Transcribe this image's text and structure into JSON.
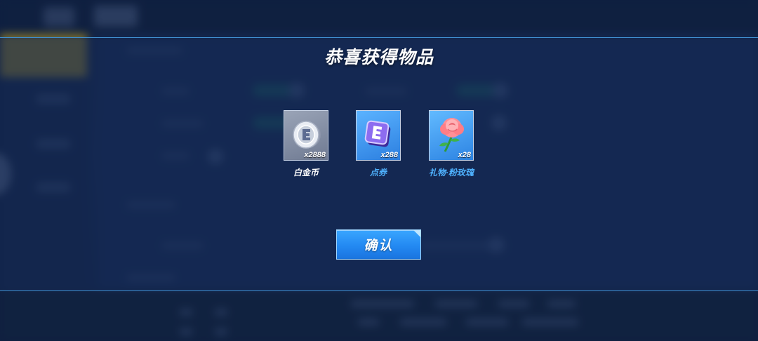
{
  "dialog": {
    "title": "恭喜获得物品",
    "confirm_label": "确认"
  },
  "rewards": [
    {
      "name": "白金币",
      "quantity": "x2888",
      "icon": "platinum-coin-icon",
      "name_color": "#ffffff"
    },
    {
      "name": "点券",
      "quantity": "x288",
      "icon": "voucher-icon",
      "name_color": "#4fb2ff"
    },
    {
      "name": "礼物·粉玫瑰",
      "quantity": "x28",
      "icon": "pink-rose-icon",
      "name_color": "#4fb2ff"
    }
  ],
  "colors": {
    "accent": "#2389f2",
    "highlight_name": "#4fb2ff",
    "band_border": "#3f8fcf"
  }
}
